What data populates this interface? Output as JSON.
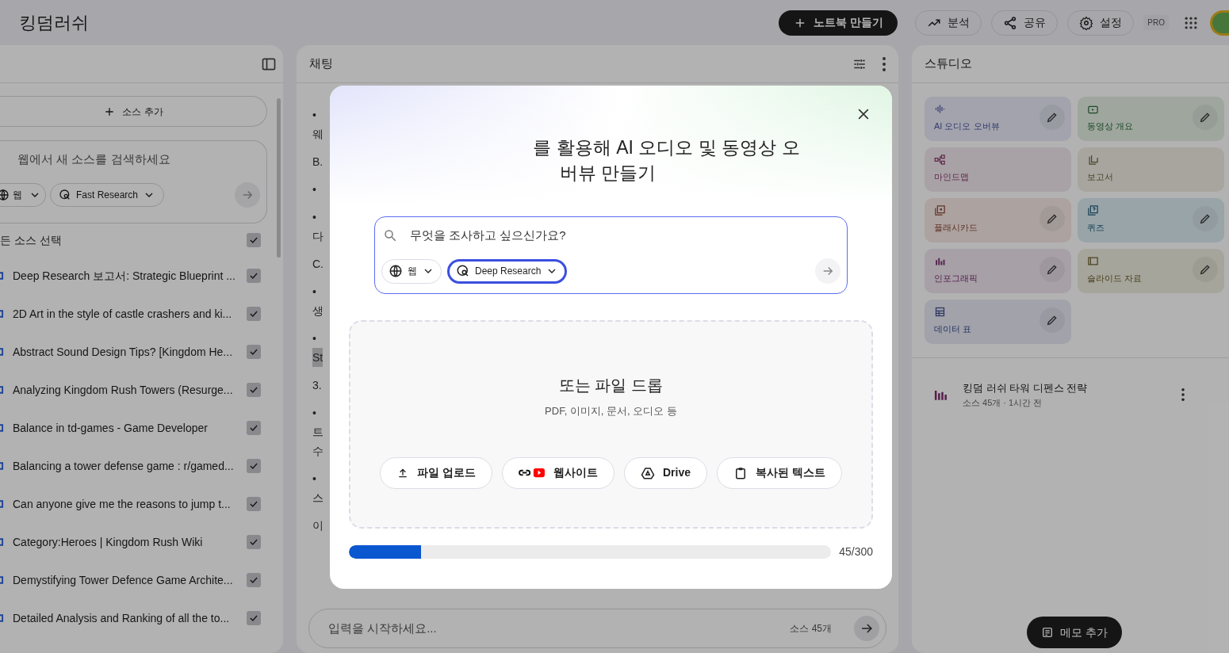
{
  "header": {
    "title": "킹덤러쉬",
    "create_button": "노트북 만들기",
    "actions": [
      {
        "kind": "analytics",
        "label": "분석"
      },
      {
        "kind": "share",
        "label": "공유"
      },
      {
        "kind": "settings",
        "label": "설정"
      }
    ],
    "badge": "PRO"
  },
  "sources": {
    "add_button": "소스 추가",
    "search": {
      "placeholder": "웹에서 새 소스를 검색하세요",
      "source_chip": "웹",
      "mode_chip": "Fast Research"
    },
    "select_all": {
      "label": "든 소스 선택",
      "checked": true
    },
    "items": [
      {
        "title": "Deep Research 보고서: Strategic Blueprint ...",
        "checked": true
      },
      {
        "title": "2D Art in the style of castle crashers and ki...",
        "checked": true
      },
      {
        "title": "Abstract Sound Design Tips? [Kingdom He...",
        "checked": true
      },
      {
        "title": "Analyzing Kingdom Rush Towers (Resurge...",
        "checked": true
      },
      {
        "title": "Balance in td-games - Game Developer",
        "checked": true
      },
      {
        "title": "Balancing a tower defense game : r/gamed...",
        "checked": true
      },
      {
        "title": "Can anyone give me the reasons to jump t...",
        "checked": true
      },
      {
        "title": "Category:Heroes | Kingdom Rush Wiki",
        "checked": true
      },
      {
        "title": "Demystifying Tower Defence Game Archite...",
        "checked": true
      },
      {
        "title": "Detailed Analysis and Ranking of all the to...",
        "checked": true
      }
    ]
  },
  "chat": {
    "title": "채팅",
    "paragraphs": [
      [
        {
          "text": "•",
          "highlighted": false
        },
        {
          "text": "웨",
          "highlighted": false
        }
      ],
      [
        {
          "text": "B.",
          "highlighted": false
        }
      ],
      [
        {
          "text": "•",
          "highlighted": false
        }
      ],
      [
        {
          "text": "•",
          "highlighted": false
        },
        {
          "text": "다",
          "highlighted": false
        }
      ],
      [
        {
          "text": "C.",
          "highlighted": false
        }
      ],
      [
        {
          "text": "•",
          "highlighted": false
        },
        {
          "text": "생",
          "highlighted": false
        }
      ],
      [
        {
          "text": "•",
          "highlighted": false
        },
        {
          "text": "St",
          "highlighted": true
        }
      ],
      [
        {
          "text": "3.",
          "highlighted": false
        }
      ],
      [
        {
          "text": "•",
          "highlighted": false
        },
        {
          "text": "트",
          "highlighted": false
        },
        {
          "text": "수",
          "highlighted": false
        }
      ],
      [
        {
          "text": "•",
          "highlighted": false
        },
        {
          "text": "스",
          "highlighted": false
        }
      ],
      [
        {
          "text": "이",
          "highlighted": false
        }
      ]
    ],
    "input": {
      "placeholder": "입력을 시작하세요...",
      "count": "소스 45개"
    }
  },
  "studio": {
    "title": "스튜디오",
    "cards": [
      {
        "kind": "audio",
        "label": "AI 오디오 오버뷰",
        "editable": true
      },
      {
        "kind": "video",
        "label": "동영상 개요",
        "editable": true
      },
      {
        "kind": "mindmap",
        "label": "마인드맵",
        "editable": false
      },
      {
        "kind": "report",
        "label": "보고서",
        "editable": false
      },
      {
        "kind": "flashcards",
        "label": "플래시카드",
        "editable": true
      },
      {
        "kind": "quiz",
        "label": "퀴즈",
        "editable": true
      },
      {
        "kind": "infographic",
        "label": "인포그래픽",
        "editable": true
      },
      {
        "kind": "slides",
        "label": "슬라이드 자료",
        "editable": true
      },
      {
        "kind": "table",
        "label": "데이터 표",
        "editable": true
      }
    ],
    "note": {
      "title": "킹덤 러쉬 타워 디펜스 전략",
      "meta": "소스 45개 · 1시간 전"
    },
    "memo_button": "메모 추가"
  },
  "dialog": {
    "title_lines": [
      "를 활용해 AI 오디오 및 동영상 오",
      "버뷰 만들기"
    ],
    "search": {
      "placeholder": "무엇을 조사하고 싶으신가요?",
      "chips": [
        {
          "label": "웹",
          "kind": "web",
          "selected": false
        },
        {
          "label": "Deep Research",
          "kind": "deep",
          "selected": true
        }
      ]
    },
    "drop": {
      "title": "또는 파일 드롭",
      "subtitle": "PDF, 이미지, 문서, 오디오 등",
      "buttons": [
        {
          "kind": "upload",
          "label": "파일 업로드"
        },
        {
          "kind": "website",
          "label": "웹사이트"
        },
        {
          "kind": "drive",
          "label": "Drive"
        },
        {
          "kind": "paste",
          "label": "복사된 텍스트"
        }
      ]
    },
    "limit": {
      "level": 0.15,
      "reading": "45/300"
    }
  }
}
